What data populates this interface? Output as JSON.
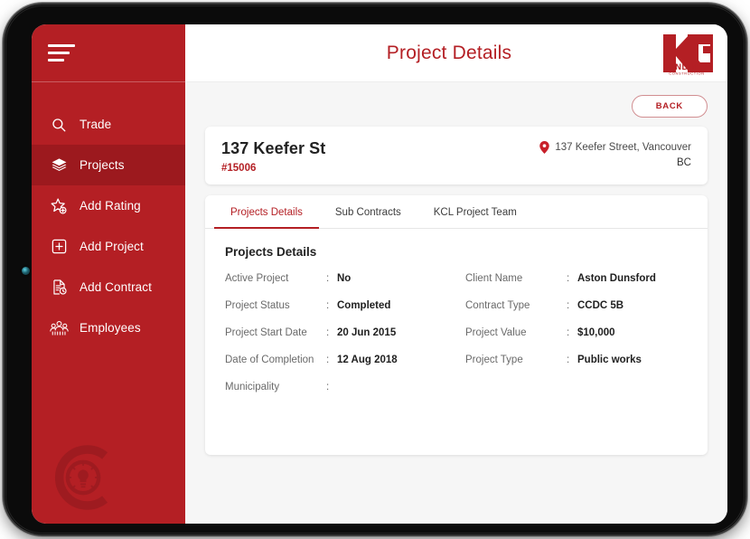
{
  "app": {
    "page_title": "Project Details",
    "brand_name": "KC",
    "brand_line1": "KINDRED",
    "brand_line2": "CONSTRUCTION",
    "accent_color": "#b41f24",
    "sidebar_color": "#b41f24",
    "sidebar_active_color": "#9c191e"
  },
  "sidebar": {
    "menu_icon": "hamburger-icon",
    "watermark_icon": "c-lightbulb-watermark",
    "items": [
      {
        "label": "Trade",
        "icon": "search-icon",
        "active": false
      },
      {
        "label": "Projects",
        "icon": "layers-icon",
        "active": true
      },
      {
        "label": "Add Rating",
        "icon": "star-plus-icon",
        "active": false
      },
      {
        "label": "Add Project",
        "icon": "square-plus-icon",
        "active": false
      },
      {
        "label": "Add Contract",
        "icon": "document-clock-icon",
        "active": false
      },
      {
        "label": "Employees",
        "icon": "people-icon",
        "active": false
      }
    ]
  },
  "toolbar": {
    "back_label": "BACK"
  },
  "project": {
    "title": "137 Keefer St",
    "code": "#15006",
    "address_icon": "map-pin-icon",
    "address_line1": "137 Keefer Street, Vancouver",
    "address_line2": "BC"
  },
  "tabs": [
    {
      "label": "Projects Details",
      "active": true
    },
    {
      "label": "Sub Contracts",
      "active": false
    },
    {
      "label": "KCL Project Team",
      "active": false
    }
  ],
  "details": {
    "heading": "Projects Details",
    "separator": ":",
    "left_column": [
      {
        "label": "Active Project",
        "value": "No"
      },
      {
        "label": "Project Status",
        "value": "Completed"
      },
      {
        "label": "Project Start Date",
        "value": "20 Jun 2015"
      },
      {
        "label": "Date of Completion",
        "value": "12 Aug 2018"
      },
      {
        "label": "Municipality",
        "value": ""
      }
    ],
    "right_column": [
      {
        "label": "Client Name",
        "value": "Aston Dunsford"
      },
      {
        "label": "Contract Type",
        "value": "CCDC 5B"
      },
      {
        "label": "Project Value",
        "value": "$10,000"
      },
      {
        "label": "Project Type",
        "value": "Public works"
      }
    ]
  }
}
